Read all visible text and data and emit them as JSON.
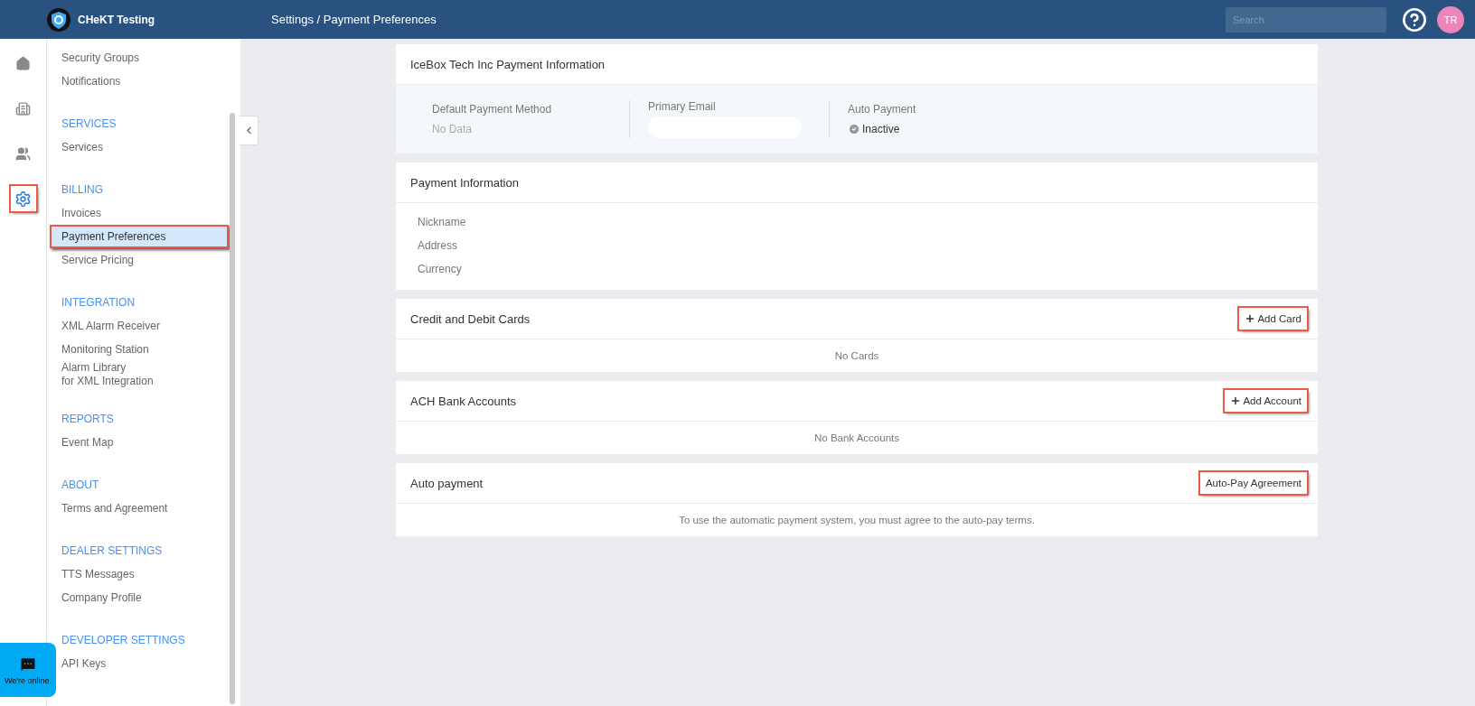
{
  "header": {
    "brand": "CHeKT Testing",
    "breadcrumb": "Settings / Payment Preferences",
    "search": {
      "placeholder": "Search"
    },
    "avatar": "TR"
  },
  "rail": [
    {
      "kind": "home",
      "selected": false,
      "highlighted": false
    },
    {
      "kind": "building",
      "selected": false,
      "highlighted": false
    },
    {
      "kind": "people",
      "selected": false,
      "highlighted": false
    },
    {
      "kind": "settings",
      "selected": true,
      "highlighted": true
    }
  ],
  "sidebar": {
    "sections": [
      {
        "items": [
          {
            "label": "Security Groups",
            "selected": false,
            "highlighted": false
          },
          {
            "label": "Notifications",
            "selected": false,
            "highlighted": false
          }
        ]
      },
      {
        "title": "SERVICES",
        "items": [
          {
            "label": "Services",
            "selected": false,
            "highlighted": false
          }
        ]
      },
      {
        "title": "BILLING",
        "items": [
          {
            "label": "Invoices",
            "selected": false,
            "highlighted": false
          },
          {
            "label": "Payment Preferences",
            "selected": true,
            "highlighted": true
          },
          {
            "label": "Service Pricing",
            "selected": false,
            "highlighted": false
          }
        ]
      },
      {
        "title": "INTEGRATION",
        "items": [
          {
            "label": "XML Alarm Receiver",
            "selected": false,
            "highlighted": false
          },
          {
            "label": "Monitoring Station",
            "selected": false,
            "highlighted": false
          },
          {
            "label": "Alarm Library\nfor XML Integration",
            "selected": false,
            "highlighted": false
          }
        ]
      },
      {
        "title": "REPORTS",
        "items": [
          {
            "label": "Event Map",
            "selected": false,
            "highlighted": false
          }
        ]
      },
      {
        "title": "ABOUT",
        "items": [
          {
            "label": "Terms and Agreement",
            "selected": false,
            "highlighted": false
          }
        ]
      },
      {
        "title": "DEALER SETTINGS",
        "items": [
          {
            "label": "TTS Messages",
            "selected": false,
            "highlighted": false
          },
          {
            "label": "Company Profile",
            "selected": false,
            "highlighted": false
          }
        ]
      },
      {
        "title": "DEVELOPER SETTINGS",
        "items": [
          {
            "label": "API Keys",
            "selected": false,
            "highlighted": false
          }
        ]
      }
    ]
  },
  "summary": {
    "title": "IceBox Tech Inc Payment Information",
    "fields": [
      {
        "label": "Default Payment Method",
        "value": "No Data",
        "kind": "text"
      },
      {
        "label": "Primary Email",
        "kind": "redacted"
      },
      {
        "label": "Auto Payment",
        "value": "Inactive",
        "kind": "status"
      }
    ]
  },
  "payment_information": {
    "title": "Payment Information",
    "fields": [
      "Nickname",
      "Address",
      "Currency"
    ]
  },
  "sections": [
    {
      "title": "Credit and Debit Cards",
      "button": {
        "label": "Add Card",
        "plus": true,
        "highlighted": true
      },
      "message": "No Cards"
    },
    {
      "title": "ACH Bank Accounts",
      "button": {
        "label": "Add Account",
        "plus": true,
        "highlighted": true
      },
      "message": "No Bank Accounts"
    },
    {
      "title": "Auto payment",
      "button": {
        "label": "Auto-Pay Agreement",
        "plus": false,
        "highlighted": true
      },
      "message": "To use the automatic payment system, you must agree to the auto-pay terms."
    }
  ],
  "chat": {
    "label": "We're online."
  }
}
